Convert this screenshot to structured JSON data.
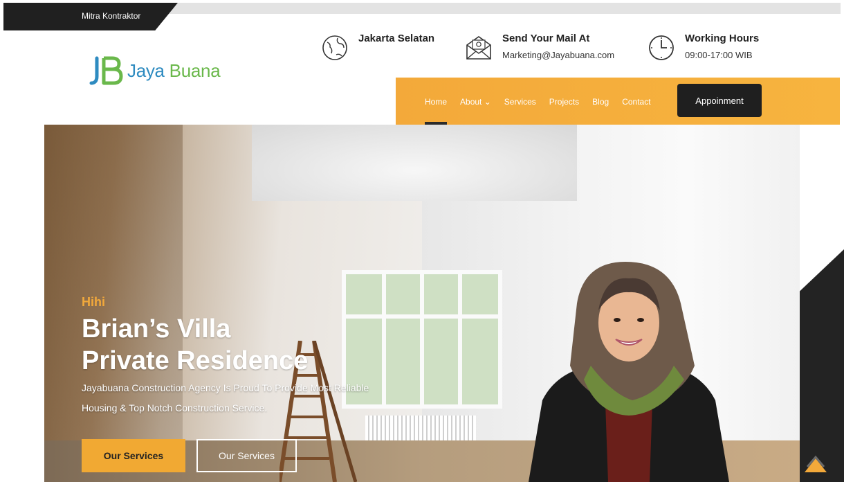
{
  "topbar": {
    "tag": "Mitra Kontraktor"
  },
  "logo": {
    "mark": "JB",
    "brand_a": "Jaya",
    "brand_b": "Buana"
  },
  "info": [
    {
      "icon": "globe-icon",
      "title": "Jakarta Selatan",
      "sub": ""
    },
    {
      "icon": "mail-icon",
      "title": "Send Your Mail At",
      "sub": "Marketing@Jayabuana.com"
    },
    {
      "icon": "clock-icon",
      "title": "Working Hours",
      "sub": "09:00-17:00 WIB"
    }
  ],
  "nav": {
    "items": [
      "Home",
      "About",
      "Services",
      "Projects",
      "Blog",
      "Contact"
    ],
    "about_chevron": "⌄",
    "appointment": "Appoinment"
  },
  "hero": {
    "eyebrow": "Hihi",
    "heading_line1": "Brian’s Villa",
    "heading_line2": "Private Residence",
    "desc_line1": "Jayabuana Construction Agency Is Proud To Provide Most Reliable",
    "desc_line2": "Housing & Top Notch Construction Service.",
    "btn_primary": "Our Services",
    "btn_secondary": "Our Services"
  },
  "colors": {
    "accent": "#f3a93a",
    "dark": "#202020",
    "logo_blue": "#2e8bc0",
    "logo_green": "#6ab84b"
  }
}
